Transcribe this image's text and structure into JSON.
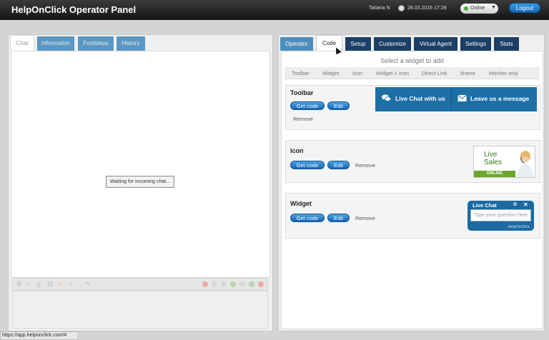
{
  "header": {
    "title": "HelpOnClick Operator Panel",
    "user": "Tatiana N",
    "datetime": "28.03.2016 17:28",
    "status": "Online",
    "logout_label": "Logout",
    "colors": {
      "bar": "#222222",
      "accent": "#1e7bd0",
      "online": "#4caf3a"
    }
  },
  "left_tabs": [
    {
      "label": "Chat"
    },
    {
      "label": "Information"
    },
    {
      "label": "Footsteps"
    },
    {
      "label": "History"
    }
  ],
  "chat": {
    "waiting_text": "Waiting for incoming chat...",
    "editor_toolbar_icons": [
      "bold-icon",
      "italic-icon",
      "underline-icon",
      "link-icon",
      "emoji-icon",
      "color-icon",
      "attachment-icon"
    ]
  },
  "right_tabs": [
    {
      "label": "Operator"
    },
    {
      "label": "Code"
    },
    {
      "label": "Setup"
    },
    {
      "label": "Customize"
    },
    {
      "label": "Virtual Agent"
    },
    {
      "label": "Settings"
    },
    {
      "label": "Stats"
    }
  ],
  "code": {
    "select_title": "Select a widget to add",
    "widget_tabs": [
      "Toolbar",
      "Widget",
      "Icon",
      "Widget + Icon",
      "Direct Link",
      "iframe",
      "Monitor only"
    ],
    "cards": {
      "toolbar": {
        "title": "Toolbar",
        "get_code": "Get code",
        "edit": "Edit",
        "remove": "Remove",
        "preview_chat": "Live Chat with us",
        "preview_message": "Leave us a message"
      },
      "icon": {
        "title": "Icon",
        "get_code": "Get code",
        "edit": "Edit",
        "remove": "Remove",
        "preview_line1": "Live",
        "preview_line2": "Sales",
        "preview_status": "ONLINE"
      },
      "widget": {
        "title": "Widget",
        "get_code": "Get code",
        "edit": "Edit",
        "remove": "Remove",
        "preview_title": "Live Chat",
        "preview_placeholder": "Type your question here",
        "preview_brand": "HelpOnClick"
      }
    }
  },
  "statusbar": {
    "url": "https://app.helponclick.com/#"
  }
}
